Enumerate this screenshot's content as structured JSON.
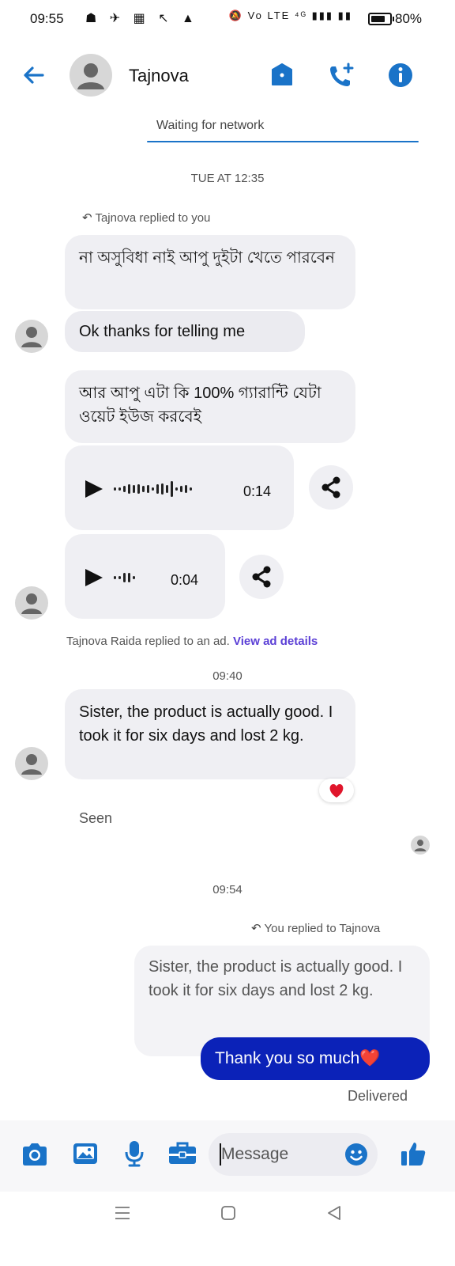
{
  "status_bar": {
    "time": "09:55",
    "left_icons": "☗ ✈ ▦ ↖ ▲",
    "right_icons": "🔕 Vo LTE ⁴ᴳ ▮▮▮ ▮▮",
    "battery": "80%"
  },
  "header": {
    "contact_name": "Tajnova",
    "network_status": "Waiting for network",
    "icons": [
      "back-arrow-icon",
      "shield-icon",
      "call-add-icon",
      "info-icon"
    ]
  },
  "thread": {
    "time_1": "TUE AT 12:35",
    "reply_note_1": "Tajnova replied to you",
    "msg_1": "না অসুবিধা নাই আপু দুইটা খেতে পারবেন",
    "msg_2": "Ok thanks for telling me",
    "msg_3": "আর আপু এটা কি 100% গ্যারান্টি যেটা ওয়েট ইউজ করবেই",
    "audio_1_duration": "0:14",
    "audio_2_duration": "0:04",
    "ad_note": "Tajnova Raida replied to an ad.",
    "ad_link": "View ad details",
    "time_2": "09:40",
    "msg_4": "Sister, the product is actually good. I took it for six days and lost 2 kg.",
    "reaction": "❤️",
    "seen": "Seen",
    "time_3": "09:54",
    "reply_note_2": "You replied to Tajnova",
    "quoted": "Sister, the product is actually good. I took it for six days and lost 2 kg.",
    "sent_msg": "Thank you so much❤️",
    "delivered": "Delivered"
  },
  "composer": {
    "placeholder": "Message",
    "icons": [
      "camera-icon",
      "image-icon",
      "microphone-icon",
      "toolbox-icon",
      "emoji-icon",
      "thumbs-up-icon"
    ]
  },
  "nav": {
    "icons": [
      "menu-nav-icon",
      "home-nav-icon",
      "back-nav-icon"
    ]
  },
  "colors": {
    "accent": "#1a73c8",
    "sent_bubble": "#0b22b8",
    "received_bubble": "#efeff3",
    "link": "#5b3fd6"
  }
}
